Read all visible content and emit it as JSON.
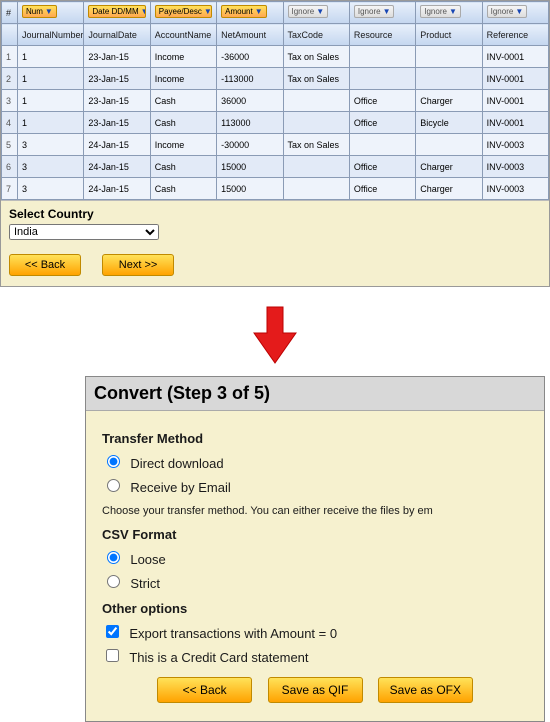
{
  "grid": {
    "idx_header": "#",
    "mappings": [
      {
        "label": "Num",
        "ignore": false
      },
      {
        "label": "Date DD/MM",
        "ignore": false
      },
      {
        "label": "Payee/Desc",
        "ignore": false
      },
      {
        "label": "Amount",
        "ignore": false
      },
      {
        "label": "Ignore",
        "ignore": true
      },
      {
        "label": "Ignore",
        "ignore": true
      },
      {
        "label": "Ignore",
        "ignore": true
      },
      {
        "label": "Ignore",
        "ignore": true
      }
    ],
    "columns": [
      "JournalNumber",
      "JournalDate",
      "AccountName",
      "NetAmount",
      "TaxCode",
      "Resource",
      "Product",
      "Reference"
    ],
    "rows": [
      {
        "idx": "1",
        "cells": [
          "1",
          "23-Jan-15",
          "Income",
          "-36000",
          "Tax on Sales",
          "",
          "",
          "INV-0001"
        ]
      },
      {
        "idx": "2",
        "cells": [
          "1",
          "23-Jan-15",
          "Income",
          "-113000",
          "Tax on Sales",
          "",
          "",
          "INV-0001"
        ]
      },
      {
        "idx": "3",
        "cells": [
          "1",
          "23-Jan-15",
          "Cash",
          "36000",
          "",
          "Office",
          "Charger",
          "INV-0001"
        ]
      },
      {
        "idx": "4",
        "cells": [
          "1",
          "23-Jan-15",
          "Cash",
          "113000",
          "",
          "Office",
          "Bicycle",
          "INV-0001"
        ]
      },
      {
        "idx": "5",
        "cells": [
          "3",
          "24-Jan-15",
          "Income",
          "-30000",
          "Tax on Sales",
          "",
          "",
          "INV-0003"
        ]
      },
      {
        "idx": "6",
        "cells": [
          "3",
          "24-Jan-15",
          "Cash",
          "15000",
          "",
          "Office",
          "Charger",
          "INV-0003"
        ]
      },
      {
        "idx": "7",
        "cells": [
          "3",
          "24-Jan-15",
          "Cash",
          "15000",
          "",
          "Office",
          "Charger",
          "INV-0003"
        ]
      }
    ]
  },
  "country": {
    "label": "Select Country",
    "value": "India"
  },
  "nav": {
    "back": "<< Back",
    "next": "Next >>"
  },
  "step3": {
    "title": "Convert (Step 3 of 5)",
    "transfer_label": "Transfer Method",
    "direct": "Direct download",
    "email": "Receive by Email",
    "desc": "Choose your transfer method. You can either receive the files by em",
    "csv_label": "CSV Format",
    "loose": "Loose",
    "strict": "Strict",
    "other_label": "Other options",
    "opt_zero": "Export transactions with Amount = 0",
    "opt_cc": "This is a Credit Card statement",
    "back": "<< Back",
    "save_qif": "Save as QIF",
    "save_ofx": "Save as OFX"
  }
}
